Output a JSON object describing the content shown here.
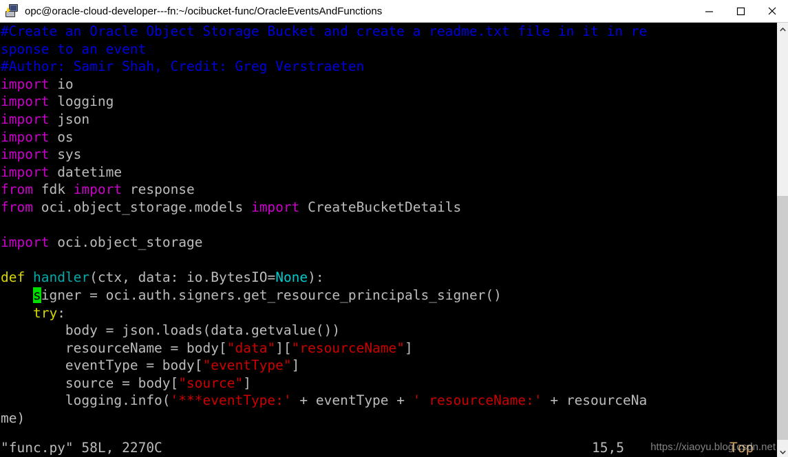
{
  "window": {
    "title": "opc@oracle-cloud-developer---fn:~/ocibucket-func/OracleEventsAndFunctions",
    "icon": "putty-terminal-icon",
    "controls": {
      "minimize": "minimize-icon",
      "maximize": "maximize-icon",
      "close": "close-icon"
    }
  },
  "editor": {
    "application": "vim",
    "colors": {
      "background": "#000000",
      "foreground": "#bcbcbc",
      "comment": "#0000dd",
      "keyword": "#cc00cc",
      "definition": "#d7d700",
      "function": "#00aaaa",
      "constant": "#00cccc",
      "string": "#cc0000",
      "cursor": "#00dd00"
    },
    "lines": [
      {
        "n": 1,
        "wrap": false,
        "tokens": [
          {
            "t": "#Create an Oracle Object Storage Bucket and create a readme.txt file in it in re",
            "c": "comment"
          }
        ]
      },
      {
        "n": 1,
        "wrap": true,
        "tokens": [
          {
            "t": "sponse to an event",
            "c": "comment"
          }
        ]
      },
      {
        "n": 2,
        "wrap": false,
        "tokens": [
          {
            "t": "#Author: Samir Shah, Credit: Greg Verstraeten",
            "c": "comment"
          }
        ]
      },
      {
        "n": 3,
        "wrap": false,
        "tokens": [
          {
            "t": "import",
            "c": "kw"
          },
          {
            "t": " io",
            "c": "ident"
          }
        ]
      },
      {
        "n": 4,
        "wrap": false,
        "tokens": [
          {
            "t": "import",
            "c": "kw"
          },
          {
            "t": " logging",
            "c": "ident"
          }
        ]
      },
      {
        "n": 5,
        "wrap": false,
        "tokens": [
          {
            "t": "import",
            "c": "kw"
          },
          {
            "t": " json",
            "c": "ident"
          }
        ]
      },
      {
        "n": 6,
        "wrap": false,
        "tokens": [
          {
            "t": "import",
            "c": "kw"
          },
          {
            "t": " os",
            "c": "ident"
          }
        ]
      },
      {
        "n": 7,
        "wrap": false,
        "tokens": [
          {
            "t": "import",
            "c": "kw"
          },
          {
            "t": " sys",
            "c": "ident"
          }
        ]
      },
      {
        "n": 8,
        "wrap": false,
        "tokens": [
          {
            "t": "import",
            "c": "kw"
          },
          {
            "t": " datetime",
            "c": "ident"
          }
        ]
      },
      {
        "n": 9,
        "wrap": false,
        "tokens": [
          {
            "t": "from",
            "c": "kw"
          },
          {
            "t": " fdk ",
            "c": "ident"
          },
          {
            "t": "import",
            "c": "kw"
          },
          {
            "t": " response",
            "c": "ident"
          }
        ]
      },
      {
        "n": 10,
        "wrap": false,
        "tokens": [
          {
            "t": "from",
            "c": "kw"
          },
          {
            "t": " oci.object_storage.models ",
            "c": "ident"
          },
          {
            "t": "import",
            "c": "kw"
          },
          {
            "t": " CreateBucketDetails",
            "c": "ident"
          }
        ]
      },
      {
        "n": 11,
        "wrap": false,
        "tokens": [
          {
            "t": "",
            "c": "ident"
          }
        ]
      },
      {
        "n": 12,
        "wrap": false,
        "tokens": [
          {
            "t": "import",
            "c": "kw"
          },
          {
            "t": " oci.object_storage",
            "c": "ident"
          }
        ]
      },
      {
        "n": 13,
        "wrap": false,
        "tokens": [
          {
            "t": "",
            "c": "ident"
          }
        ]
      },
      {
        "n": 14,
        "wrap": false,
        "tokens": [
          {
            "t": "def",
            "c": "def"
          },
          {
            "t": " ",
            "c": "ident"
          },
          {
            "t": "handler",
            "c": "func"
          },
          {
            "t": "(ctx, data: io.BytesIO=",
            "c": "ident"
          },
          {
            "t": "None",
            "c": "const"
          },
          {
            "t": "):",
            "c": "ident"
          }
        ]
      },
      {
        "n": 15,
        "wrap": false,
        "tokens": [
          {
            "t": "    ",
            "c": "ident"
          },
          {
            "t": "s",
            "c": "cursor"
          },
          {
            "t": "igner = oci.auth.signers.get_resource_principals_signer()",
            "c": "ident"
          }
        ]
      },
      {
        "n": 16,
        "wrap": false,
        "tokens": [
          {
            "t": "    ",
            "c": "ident"
          },
          {
            "t": "try",
            "c": "def"
          },
          {
            "t": ":",
            "c": "ident"
          }
        ]
      },
      {
        "n": 17,
        "wrap": false,
        "tokens": [
          {
            "t": "        body = json.loads(data.getvalue())",
            "c": "ident"
          }
        ]
      },
      {
        "n": 18,
        "wrap": false,
        "tokens": [
          {
            "t": "        resourceName = body[",
            "c": "ident"
          },
          {
            "t": "\"data\"",
            "c": "str"
          },
          {
            "t": "][",
            "c": "ident"
          },
          {
            "t": "\"resourceName\"",
            "c": "str"
          },
          {
            "t": "]",
            "c": "ident"
          }
        ]
      },
      {
        "n": 19,
        "wrap": false,
        "tokens": [
          {
            "t": "        eventType = body[",
            "c": "ident"
          },
          {
            "t": "\"eventType\"",
            "c": "str"
          },
          {
            "t": "]",
            "c": "ident"
          }
        ]
      },
      {
        "n": 20,
        "wrap": false,
        "tokens": [
          {
            "t": "        source = body[",
            "c": "ident"
          },
          {
            "t": "\"source\"",
            "c": "str"
          },
          {
            "t": "]",
            "c": "ident"
          }
        ]
      },
      {
        "n": 21,
        "wrap": false,
        "tokens": [
          {
            "t": "        logging.info(",
            "c": "ident"
          },
          {
            "t": "'***eventType:'",
            "c": "str"
          },
          {
            "t": " + eventType + ",
            "c": "ident"
          },
          {
            "t": "' resourceName:'",
            "c": "str"
          },
          {
            "t": " + resourceNa",
            "c": "ident"
          }
        ]
      },
      {
        "n": 21,
        "wrap": true,
        "tokens": [
          {
            "t": "me)",
            "c": "ident"
          }
        ]
      }
    ]
  },
  "statusline": {
    "file": "\"func.py\" 58L, 2270C",
    "position": "15,5",
    "scroll_state": "Top"
  },
  "scrollbar": {
    "up_arrow": "chevron-up-icon",
    "down_arrow": "chevron-down-icon"
  },
  "watermark": {
    "text": "https://xiaoyu.blog.csdn.net"
  }
}
